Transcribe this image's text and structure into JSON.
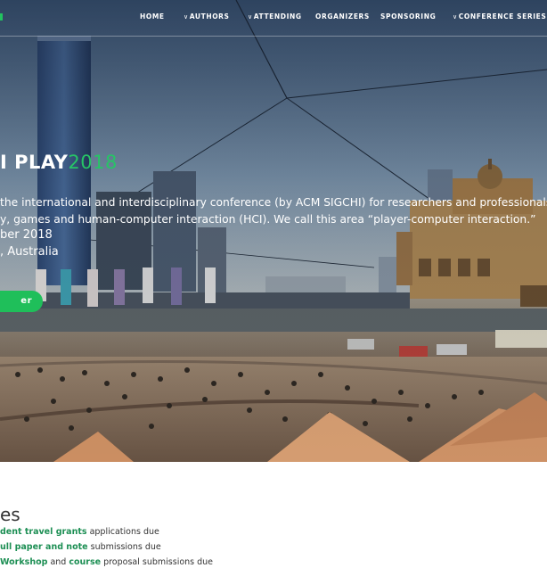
{
  "nav": {
    "items": [
      {
        "label": "HOME",
        "has_dropdown": false
      },
      {
        "label": "AUTHORS",
        "has_dropdown": true
      },
      {
        "label": "ATTENDING",
        "has_dropdown": true
      },
      {
        "label": "ORGANIZERS",
        "has_dropdown": false
      },
      {
        "label": "SPONSORING",
        "has_dropdown": false
      },
      {
        "label": "CONFERENCE SERIES",
        "has_dropdown": true
      }
    ],
    "chevron_icon": "chevron-down-icon"
  },
  "hero": {
    "title_main": "I PLAY",
    "title_year": "2018",
    "description_line1": "the international and interdisciplinary conference (by ACM SIGCHI) for researchers and professionals a",
    "description_line2": "y, games and human-computer interaction (HCI). We call this area “player-computer interaction.”",
    "date": "ber 2018",
    "location": ", Australia",
    "button_label": "er",
    "accent_color": "#27c466"
  },
  "dates": {
    "heading": "es",
    "items": [
      {
        "highlight": "dent travel grants",
        "rest": " applications due"
      },
      {
        "highlight": "ull paper and note",
        "rest": " submissions due"
      },
      {
        "highlight": "Workshop",
        "middle": " and ",
        "highlight2": "course",
        "rest": " proposal submissions due"
      }
    ]
  },
  "colors": {
    "accent": "#1fbf5a",
    "link": "#1d8f54",
    "text": "#333333"
  }
}
